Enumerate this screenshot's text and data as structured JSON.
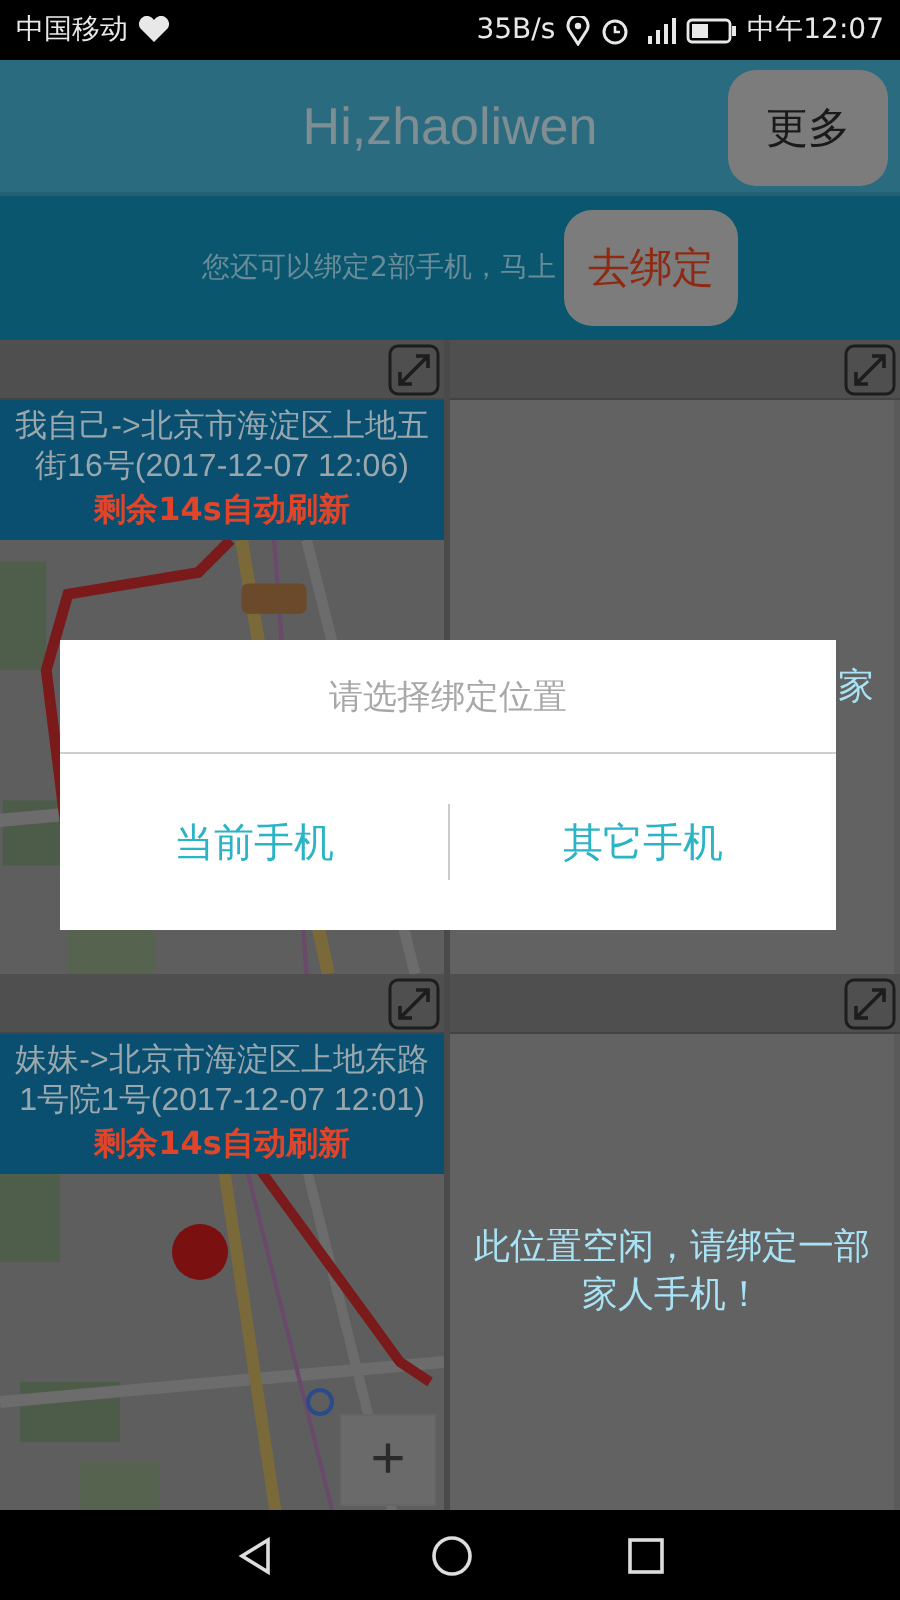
{
  "status_bar": {
    "carrier": "中国移动",
    "speed": "35B/s",
    "time": "中午12:07"
  },
  "header": {
    "title": "Hi,zhaoliwen",
    "more_button": "更多"
  },
  "banner": {
    "text": "您还可以绑定2部手机，马上",
    "bind_button": "去绑定"
  },
  "cells": [
    {
      "kind": "map",
      "info": "我自己->北京市海淀区上地五街16号(2017-12-07 12:06)",
      "refresh": "剩余14s自动刷新"
    },
    {
      "kind": "edge",
      "message": "家"
    },
    {
      "kind": "map",
      "info": "妹妹->北京市海淀区上地东路1号院1号(2017-12-07 12:01)",
      "refresh": "剩余14s自动刷新",
      "zoom_button": "+"
    },
    {
      "kind": "empty",
      "message": "此位置空闲，请绑定一部家人手机！"
    }
  ],
  "dialog": {
    "title": "请选择绑定位置",
    "options": [
      "当前手机",
      "其它手机"
    ]
  }
}
